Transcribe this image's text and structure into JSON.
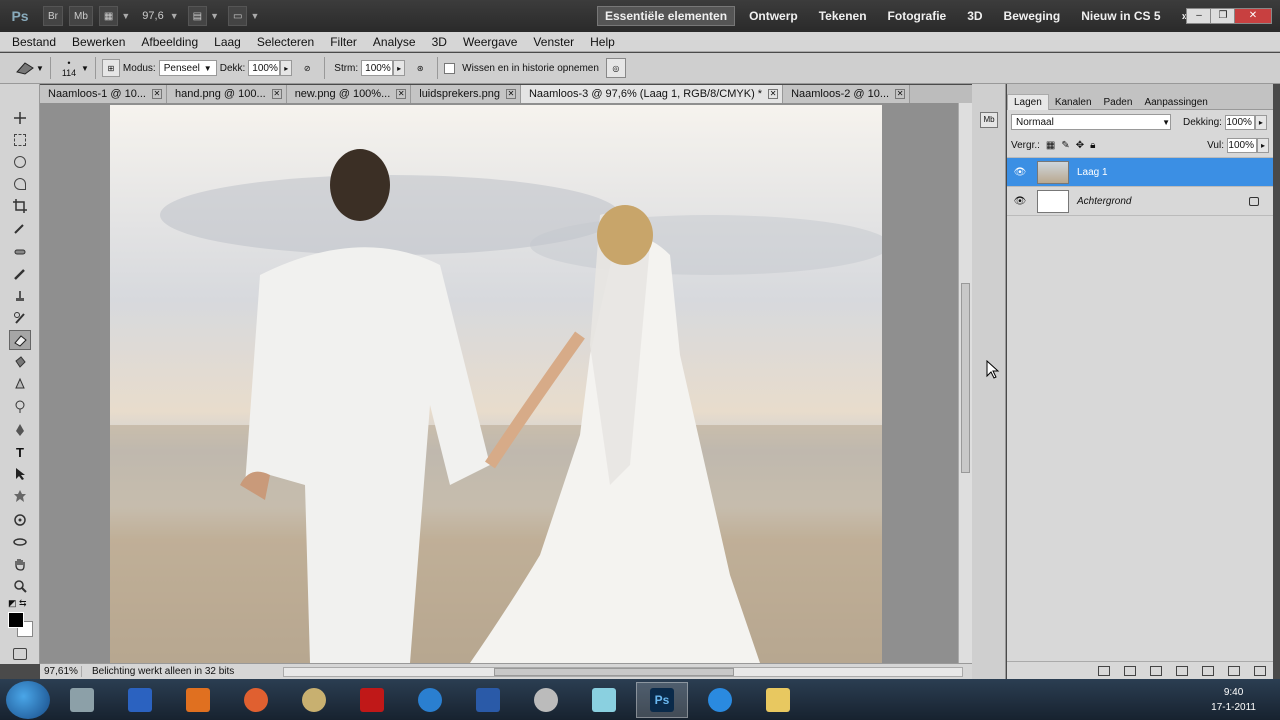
{
  "app": {
    "logo": "Ps",
    "launcher_labels": [
      "Br",
      "Mb"
    ],
    "zoom_value": "97,6",
    "workspaces": [
      "Essentiële elementen",
      "Ontwerp",
      "Tekenen",
      "Fotografie",
      "3D",
      "Beweging",
      "Nieuw in CS 5"
    ],
    "active_workspace_index": 0
  },
  "menu": {
    "items": [
      "Bestand",
      "Bewerken",
      "Afbeelding",
      "Laag",
      "Selecteren",
      "Filter",
      "Analyse",
      "3D",
      "Weergave",
      "Venster",
      "Help"
    ]
  },
  "options": {
    "brush_size": "114",
    "mode_label": "Modus:",
    "mode_value": "Penseel",
    "opacity_label": "Dekk:",
    "opacity_value": "100%",
    "flow_label": "Strm:",
    "flow_value": "100%",
    "history_label": "Wissen en in historie opnemen",
    "history_checked": false
  },
  "documents": {
    "tabs": [
      {
        "label": "Naamloos-1 @ 10...",
        "active": false
      },
      {
        "label": "hand.png @ 100...",
        "active": false
      },
      {
        "label": "new.png @ 100%...",
        "active": false
      },
      {
        "label": "luidsprekers.png",
        "active": false
      },
      {
        "label": "Naamloos-3 @ 97,6% (Laag 1, RGB/8/CMYK) *",
        "active": true
      },
      {
        "label": "Naamloos-2 @ 10...",
        "active": false
      }
    ]
  },
  "status": {
    "zoom": "97,61%",
    "info": "Belichting werkt alleen in 32 bits"
  },
  "layers_panel": {
    "tabs": [
      "Lagen",
      "Kanalen",
      "Paden",
      "Aanpassingen"
    ],
    "active_tab_index": 0,
    "blend_mode": "Normaal",
    "opacity_label": "Dekking:",
    "opacity_value": "100%",
    "lock_label": "Vergr.:",
    "fill_label": "Vul:",
    "fill_value": "100%",
    "layers": [
      {
        "name": "Laag 1",
        "selected": true,
        "locked": false
      },
      {
        "name": "Achtergrond",
        "selected": false,
        "locked": true
      }
    ]
  },
  "tools": {
    "active": "eraser-tool"
  },
  "taskbar": {
    "time": "9:40",
    "date": "17-1-2011",
    "active_app": "photoshop"
  },
  "colors": {
    "selection_blue": "#3b8fe4",
    "chrome_dark": "#3a3a3a",
    "panel_gray": "#d6d6d6"
  }
}
